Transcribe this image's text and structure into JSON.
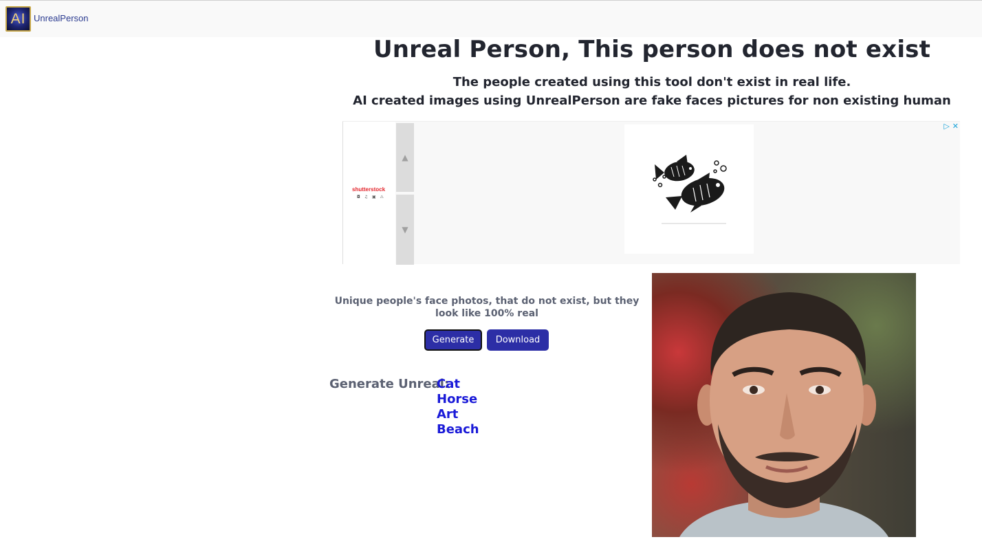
{
  "header": {
    "logo_text": "AI",
    "brand": "UnrealPerson"
  },
  "main": {
    "title": "Unreal Person, This person does not exist",
    "subtitle_1": "The people created using this tool don't exist in real life.",
    "subtitle_2": "AI created images using UnrealPerson are fake faces pictures for non existing human"
  },
  "ad": {
    "advertiser": "shutterstock",
    "advertiser_icons": "◘ ♫ ▣ ⚠",
    "scroll_up": "▲",
    "scroll_down": "▼",
    "adchoices_icon": "▷",
    "close_icon": "✕"
  },
  "generator": {
    "description": "Unique people's face photos, that do not exist, but they look like 100% real",
    "generate_label": "Generate",
    "download_label": "Download",
    "generate_unreal_label": "Generate Unreal:",
    "links": [
      "Cat",
      "Horse",
      "Art",
      "Beach"
    ]
  },
  "colors": {
    "button_bg": "#2c2ea6",
    "link": "#1a1ad8",
    "title": "#22252f",
    "muted": "#5b6172"
  }
}
